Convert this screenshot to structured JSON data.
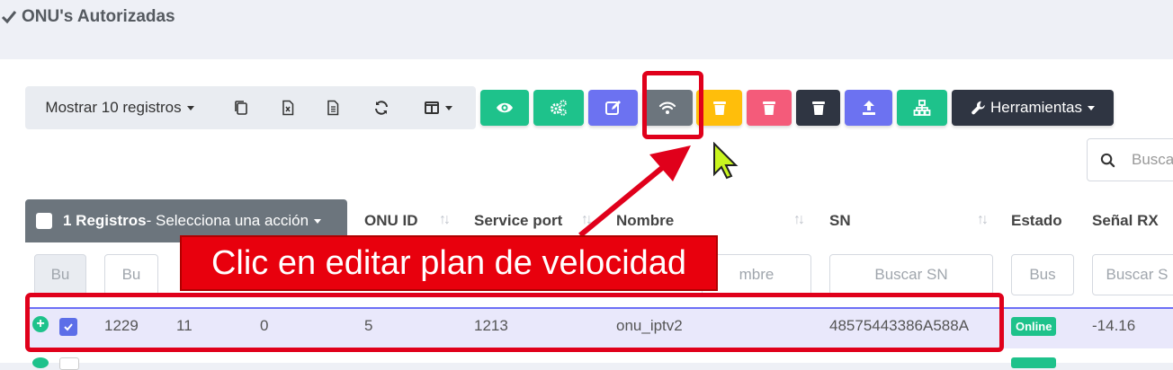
{
  "page": {
    "title": "ONU's Autorizadas"
  },
  "toolbar": {
    "show_records_label": "Mostrar 10 registros"
  },
  "actions": {
    "tools_label": "Herramientas"
  },
  "search": {
    "placeholder": "Busca"
  },
  "table": {
    "selection_count": "1 Registros",
    "selection_action": " - Selecciona una acción",
    "headers": {
      "onu_id": "ONU ID",
      "service_port": "Service port",
      "nombre": "Nombre",
      "sn": "SN",
      "estado": "Estado",
      "senal_rx": "Señal RX"
    },
    "filters": [
      "Bu",
      "Bu",
      "mbre",
      "Buscar SN",
      "Bus",
      "Buscar S"
    ],
    "row": {
      "c1": "1229",
      "c2": "11",
      "c3": "0",
      "c4": "5",
      "c5": "1213",
      "nombre": "onu_iptv2",
      "sn": "48575443386A588A",
      "estado": "Online",
      "senal_rx": "-14.16"
    }
  },
  "annotation": {
    "text": "Clic en editar plan de velocidad"
  },
  "colors": {
    "green": "#1ec28b",
    "purple": "#6c72f1",
    "gray": "#6c757d",
    "yellow": "#ffbe0b",
    "pink": "#f45b7a",
    "dark": "#2f3542",
    "red": "#e8000d"
  }
}
